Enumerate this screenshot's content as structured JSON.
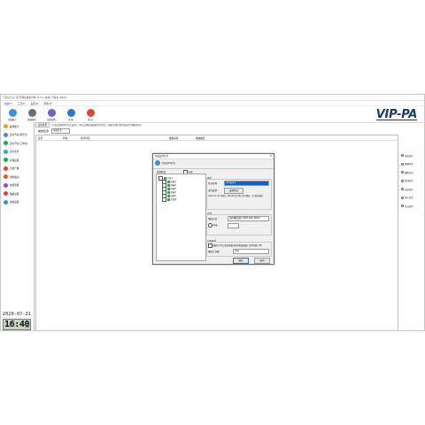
{
  "window": {
    "title": "门禁自己子门禁 管理系统客户端 V1.3.7 (版本) 开发者 (2020)"
  },
  "menu": [
    "系统(F)",
    "工具(T)",
    "设置(S)",
    "帮助(H)"
  ],
  "toolbar": [
    {
      "label": "初始账户",
      "icon": "accounts-icon",
      "color": "#3c8ed8"
    },
    {
      "label": "数据备份",
      "icon": "backup-icon",
      "color": "#6d6d6d"
    },
    {
      "label": "系统配置",
      "icon": "settings-icon",
      "color": "#7a5cc7"
    },
    {
      "label": "帮 助",
      "icon": "help-icon",
      "color": "#2f77c8"
    },
    {
      "label": "退 出",
      "icon": "exit-icon",
      "color": "#d44a3a"
    }
  ],
  "logo": "VIP-PA",
  "sidebar": [
    {
      "label": "操作账号",
      "color": "#e8a12b"
    },
    {
      "label": "定时开关(非开灯)",
      "color": "#3c8ed8"
    },
    {
      "label": "定时开关(工作时)",
      "color": "#2aa05a"
    },
    {
      "label": "定时任务",
      "color": "#3aa0d0"
    },
    {
      "label": "存储设置",
      "color": "#2aa05a"
    },
    {
      "label": "分组广播",
      "color": "#d44a3a"
    },
    {
      "label": "消防联动",
      "color": "#e35a2a"
    },
    {
      "label": "电源管理",
      "color": "#8a55c0"
    },
    {
      "label": "播放设置",
      "color": "#d44a3a"
    },
    {
      "label": "系统设置",
      "color": "#3c8ed8"
    }
  ],
  "clock": {
    "date": "2020-07-31",
    "time": "16:40",
    "seconds": "15"
  },
  "tabs": [
    "定时任务",
    "任务管理"
  ],
  "tab_note": "[可在此管理定时开关设置]，[单击右侧按钮编辑定时任务]，[选择左侧分组后修改定时播放时间]",
  "filter": {
    "label": "播放任务:",
    "value": "全部任务"
  },
  "grid_headers": [
    "任务",
    "状态",
    "执行时间",
    "",
    "",
    "播放来源",
    "播放曲目"
  ],
  "right_panel": [
    "添加任务",
    "编辑任务",
    "删除任务",
    "复制任务",
    "启动任务",
    "停止任务",
    "开启任务"
  ],
  "dialog": {
    "title": "添加定时任务",
    "close": "✕",
    "header": "添加定时任务",
    "tree_label": "选择区域",
    "tree_all": "全选",
    "tree": [
      {
        "label": "区域 1",
        "level": 0
      },
      {
        "label": "终端1",
        "level": 1
      },
      {
        "label": "终端2",
        "level": 1
      },
      {
        "label": "终端3",
        "level": 1
      },
      {
        "label": "终端4",
        "level": 1
      },
      {
        "label": "终端5",
        "level": 1
      },
      {
        "label": "全部区",
        "level": 1
      }
    ],
    "section_props": "属性",
    "name_label": "任务名称:",
    "name_value": "定时任务1",
    "time_label": "定时设置:",
    "time_button": "设置时间",
    "time_note": "2020-07-31 星期五  16时48分18秒  定时播放一次 循环播放",
    "section_source": "音源",
    "source_label": "播放方式:",
    "source_value": "选择播放曲目 (MP3,WAV,WMA)",
    "source_radio": "外接",
    "section_ext": "扩展属性",
    "ext_check": "播放完毕后关闭电源(外接电源设备) (定时(秒):45)",
    "vol_label": "播放后音量:",
    "vol_value": "不调",
    "ok": "确定",
    "cancel": "取消"
  }
}
